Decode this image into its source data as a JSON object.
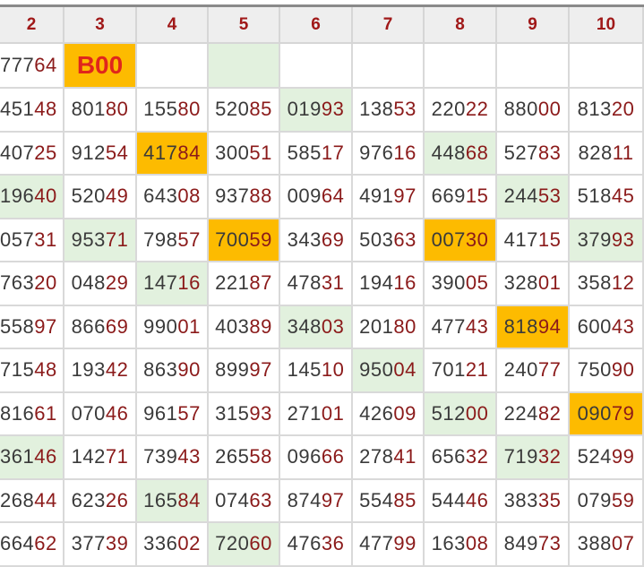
{
  "headers": [
    "2",
    "3",
    "4",
    "5",
    "6",
    "7",
    "8",
    "9",
    "10"
  ],
  "top_row": [
    {
      "p": "777",
      "s": "64",
      "bg": "",
      "first": true
    },
    {
      "text": "B00",
      "bg": "orange",
      "special": true
    },
    {
      "p": "",
      "s": "",
      "bg": ""
    },
    {
      "p": "",
      "s": "",
      "bg": "green"
    },
    {
      "p": "",
      "s": "",
      "bg": ""
    },
    {
      "p": "",
      "s": "",
      "bg": ""
    },
    {
      "p": "",
      "s": "",
      "bg": ""
    },
    {
      "p": "",
      "s": "",
      "bg": ""
    },
    {
      "p": "",
      "s": "",
      "bg": ""
    }
  ],
  "rows": [
    [
      {
        "p": "451",
        "s": "48",
        "bg": "",
        "first": true
      },
      {
        "p": "801",
        "s": "80",
        "bg": ""
      },
      {
        "p": "155",
        "s": "80",
        "bg": ""
      },
      {
        "p": "520",
        "s": "85",
        "bg": ""
      },
      {
        "p": "019",
        "s": "93",
        "bg": "green"
      },
      {
        "p": "138",
        "s": "53",
        "bg": ""
      },
      {
        "p": "220",
        "s": "22",
        "bg": ""
      },
      {
        "p": "880",
        "s": "00",
        "bg": ""
      },
      {
        "p": "813",
        "s": "20",
        "bg": ""
      }
    ],
    [
      {
        "p": "407",
        "s": "25",
        "bg": "",
        "first": true
      },
      {
        "p": "912",
        "s": "54",
        "bg": ""
      },
      {
        "p": "417",
        "s": "84",
        "bg": "orange"
      },
      {
        "p": "300",
        "s": "51",
        "bg": ""
      },
      {
        "p": "585",
        "s": "17",
        "bg": ""
      },
      {
        "p": "976",
        "s": "16",
        "bg": ""
      },
      {
        "p": "448",
        "s": "68",
        "bg": "green"
      },
      {
        "p": "527",
        "s": "83",
        "bg": ""
      },
      {
        "p": "828",
        "s": "11",
        "bg": ""
      }
    ],
    [
      {
        "p": "196",
        "s": "40",
        "bg": "green",
        "first": true
      },
      {
        "p": "520",
        "s": "49",
        "bg": ""
      },
      {
        "p": "643",
        "s": "08",
        "bg": ""
      },
      {
        "p": "937",
        "s": "88",
        "bg": ""
      },
      {
        "p": "009",
        "s": "64",
        "bg": ""
      },
      {
        "p": "491",
        "s": "97",
        "bg": ""
      },
      {
        "p": "669",
        "s": "15",
        "bg": ""
      },
      {
        "p": "244",
        "s": "53",
        "bg": "green"
      },
      {
        "p": "518",
        "s": "45",
        "bg": ""
      }
    ],
    [
      {
        "p": "057",
        "s": "31",
        "bg": "",
        "first": true
      },
      {
        "p": "953",
        "s": "71",
        "bg": "green"
      },
      {
        "p": "798",
        "s": "57",
        "bg": ""
      },
      {
        "p": "700",
        "s": "59",
        "bg": "orange"
      },
      {
        "p": "343",
        "s": "69",
        "bg": ""
      },
      {
        "p": "503",
        "s": "63",
        "bg": ""
      },
      {
        "p": "007",
        "s": "30",
        "bg": "orange"
      },
      {
        "p": "417",
        "s": "15",
        "bg": ""
      },
      {
        "p": "379",
        "s": "93",
        "bg": "green"
      }
    ],
    [
      {
        "p": "763",
        "s": "20",
        "bg": "",
        "first": true
      },
      {
        "p": "048",
        "s": "29",
        "bg": ""
      },
      {
        "p": "147",
        "s": "16",
        "bg": "green"
      },
      {
        "p": "221",
        "s": "87",
        "bg": ""
      },
      {
        "p": "478",
        "s": "31",
        "bg": ""
      },
      {
        "p": "194",
        "s": "16",
        "bg": ""
      },
      {
        "p": "390",
        "s": "05",
        "bg": ""
      },
      {
        "p": "328",
        "s": "01",
        "bg": ""
      },
      {
        "p": "358",
        "s": "12",
        "bg": ""
      }
    ],
    [
      {
        "p": "558",
        "s": "97",
        "bg": "",
        "first": true
      },
      {
        "p": "866",
        "s": "69",
        "bg": ""
      },
      {
        "p": "990",
        "s": "01",
        "bg": ""
      },
      {
        "p": "403",
        "s": "89",
        "bg": ""
      },
      {
        "p": "348",
        "s": "03",
        "bg": "green"
      },
      {
        "p": "201",
        "s": "80",
        "bg": ""
      },
      {
        "p": "477",
        "s": "43",
        "bg": ""
      },
      {
        "p": "818",
        "s": "94",
        "bg": "orange"
      },
      {
        "p": "600",
        "s": "43",
        "bg": ""
      }
    ],
    [
      {
        "p": "715",
        "s": "48",
        "bg": "",
        "first": true
      },
      {
        "p": "193",
        "s": "42",
        "bg": ""
      },
      {
        "p": "863",
        "s": "90",
        "bg": ""
      },
      {
        "p": "899",
        "s": "97",
        "bg": ""
      },
      {
        "p": "145",
        "s": "10",
        "bg": ""
      },
      {
        "p": "950",
        "s": "04",
        "bg": "green"
      },
      {
        "p": "701",
        "s": "21",
        "bg": ""
      },
      {
        "p": "240",
        "s": "77",
        "bg": ""
      },
      {
        "p": "750",
        "s": "90",
        "bg": ""
      }
    ],
    [
      {
        "p": "816",
        "s": "61",
        "bg": "",
        "first": true
      },
      {
        "p": "070",
        "s": "46",
        "bg": ""
      },
      {
        "p": "961",
        "s": "57",
        "bg": ""
      },
      {
        "p": "315",
        "s": "93",
        "bg": ""
      },
      {
        "p": "271",
        "s": "01",
        "bg": ""
      },
      {
        "p": "426",
        "s": "09",
        "bg": ""
      },
      {
        "p": "512",
        "s": "00",
        "bg": "green"
      },
      {
        "p": "224",
        "s": "82",
        "bg": ""
      },
      {
        "p": "090",
        "s": "79",
        "bg": "orange"
      }
    ],
    [
      {
        "p": "361",
        "s": "46",
        "bg": "green",
        "first": true
      },
      {
        "p": "142",
        "s": "71",
        "bg": ""
      },
      {
        "p": "739",
        "s": "43",
        "bg": ""
      },
      {
        "p": "265",
        "s": "58",
        "bg": ""
      },
      {
        "p": "096",
        "s": "66",
        "bg": ""
      },
      {
        "p": "278",
        "s": "41",
        "bg": ""
      },
      {
        "p": "656",
        "s": "32",
        "bg": ""
      },
      {
        "p": "719",
        "s": "32",
        "bg": "green"
      },
      {
        "p": "524",
        "s": "99",
        "bg": ""
      }
    ],
    [
      {
        "p": "268",
        "s": "44",
        "bg": "",
        "first": true
      },
      {
        "p": "623",
        "s": "26",
        "bg": ""
      },
      {
        "p": "165",
        "s": "84",
        "bg": "green"
      },
      {
        "p": "074",
        "s": "63",
        "bg": ""
      },
      {
        "p": "874",
        "s": "97",
        "bg": ""
      },
      {
        "p": "554",
        "s": "85",
        "bg": ""
      },
      {
        "p": "544",
        "s": "46",
        "bg": ""
      },
      {
        "p": "383",
        "s": "35",
        "bg": ""
      },
      {
        "p": "079",
        "s": "59",
        "bg": ""
      }
    ],
    [
      {
        "p": "664",
        "s": "62",
        "bg": "",
        "first": true
      },
      {
        "p": "377",
        "s": "39",
        "bg": ""
      },
      {
        "p": "336",
        "s": "02",
        "bg": ""
      },
      {
        "p": "720",
        "s": "60",
        "bg": "green"
      },
      {
        "p": "476",
        "s": "36",
        "bg": ""
      },
      {
        "p": "477",
        "s": "99",
        "bg": ""
      },
      {
        "p": "163",
        "s": "08",
        "bg": ""
      },
      {
        "p": "849",
        "s": "73",
        "bg": ""
      },
      {
        "p": "388",
        "s": "07",
        "bg": ""
      }
    ]
  ],
  "colors": {
    "prefix": "#3a3a3a",
    "suffix": "#8b1a1a",
    "highlight_green": "#e2f1de",
    "highlight_orange": "#fdbb00",
    "special_text": "#e0261c"
  }
}
